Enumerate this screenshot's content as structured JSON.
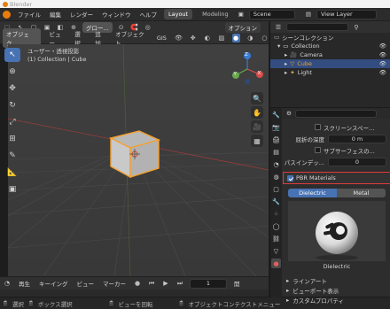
{
  "app": {
    "title": "Blender"
  },
  "topbar": {
    "menus": [
      "ファイル",
      "編集",
      "レンダー",
      "ウィンドウ",
      "ヘルプ"
    ],
    "tabs": [
      {
        "label": "Layout",
        "active": true
      },
      {
        "label": "Modeling",
        "active": false
      }
    ],
    "scene_label": "Scene",
    "view_layer_label": "View Layer"
  },
  "viewport_header": {
    "mode": "オブジェク...",
    "menus": [
      "ビュー",
      "選択",
      "追加",
      "オブジェクト",
      "GIS"
    ],
    "transform_orientation": "グロー...",
    "options_label": "オプション"
  },
  "viewport": {
    "view_name": "ユーザー・透視投影",
    "collection_info": "(1) Collection | Cube",
    "gizmo": {
      "x": "X",
      "y": "Y",
      "z": "Z"
    }
  },
  "timeline": {
    "playback": "再生",
    "keying": "キーイング",
    "view": "ビュー",
    "marker": "マーカー",
    "current_frame": "1",
    "start_label": "開",
    "end_label": "終"
  },
  "statusbar": {
    "items": [
      "選択",
      "ボックス選択",
      "ビューを回転",
      "オブジェクトコンテクストメニュー"
    ]
  },
  "outliner": {
    "root": "シーンコレクション",
    "collection": "Collection",
    "objects": [
      {
        "name": "Camera",
        "selected": false
      },
      {
        "name": "Cube",
        "selected": true
      },
      {
        "name": "Light",
        "selected": false
      }
    ]
  },
  "properties": {
    "screen_space_label": "スクリーンスペー...",
    "refraction_depth_label": "屈折の深度",
    "refraction_depth_value": "0 m",
    "subsurface_label": "サブサーフェスの...",
    "pass_index_label": "パスインデッ...",
    "pass_index_value": "0",
    "pbr_label": "PBR Materials",
    "dielectric_label": "Dielectric",
    "metal_label": "Metal",
    "preview_caption": "Dielectric",
    "line_art_label": "ラインアート",
    "viewport_display_label": "ビューポート表示",
    "custom_props_label": "カスタムプロパティ"
  },
  "colors": {
    "accent": "#4772b3",
    "highlight_red": "#e03a3a",
    "cube_outline": "#f5a02d"
  }
}
